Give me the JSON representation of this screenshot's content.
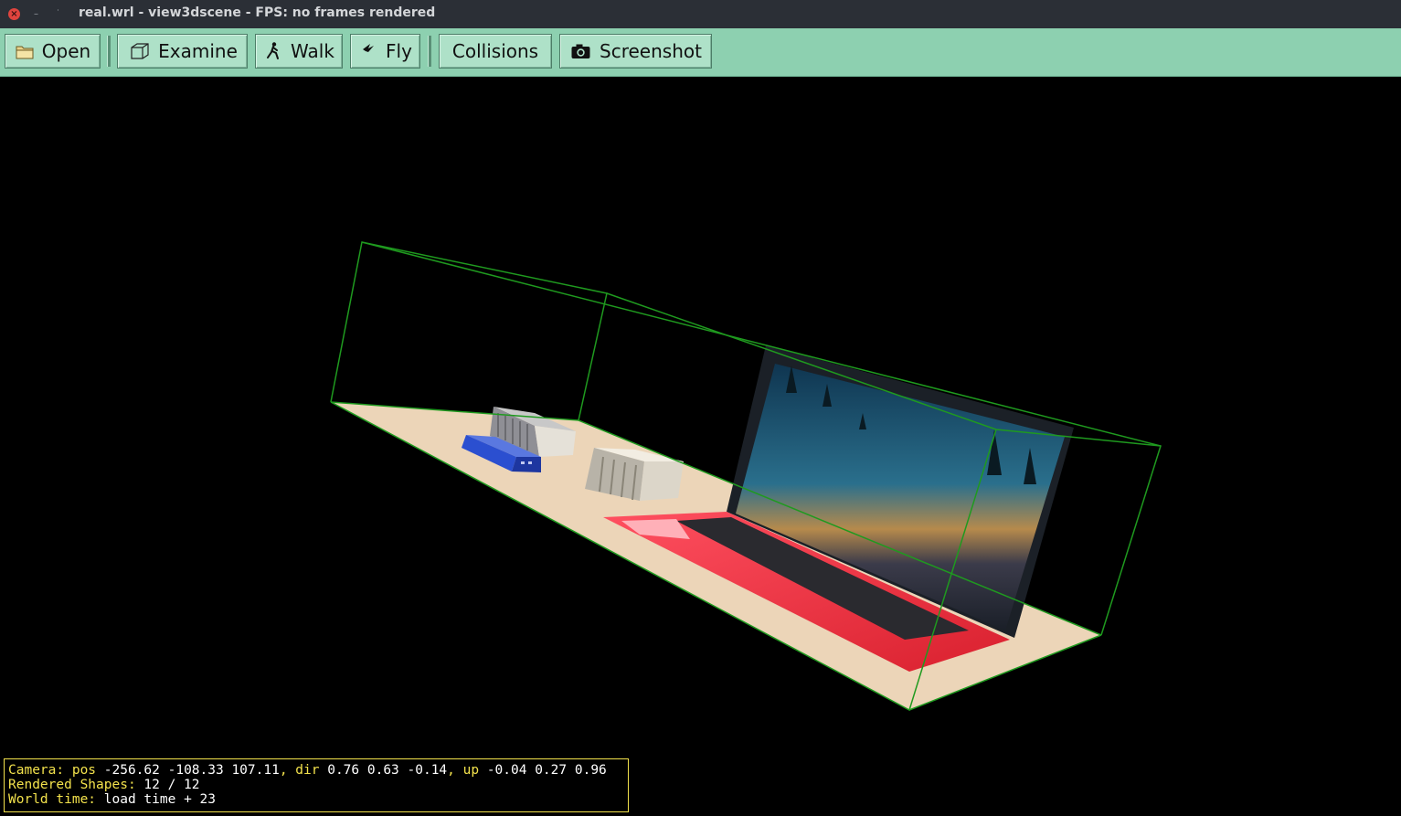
{
  "window": {
    "title": "real.wrl - view3dscene - FPS: no frames rendered"
  },
  "toolbar": {
    "open_label": "Open",
    "examine_label": "Examine",
    "walk_label": "Walk",
    "fly_label": "Fly",
    "collisions_label": "Collisions",
    "screenshot_label": "Screenshot"
  },
  "status": {
    "camera_label": "Camera: pos ",
    "pos_value": "-256.62 -108.33 107.11",
    "dir_label": ", dir ",
    "dir_value": "0.76 0.63 -0.14",
    "up_label": ", up ",
    "up_value": "-0.04 0.27 0.96",
    "shapes_label": "Rendered Shapes: ",
    "shapes_value": "12 / 12",
    "time_label": "World time: ",
    "time_value": "load time + 23"
  },
  "colors": {
    "toolbar_bg": "#8dd0b0",
    "bbox_green": "#1f9a1f",
    "status_yellow": "#f3e24c"
  },
  "icons": [
    "close-icon",
    "minimize-icon",
    "restore-icon",
    "folder-icon",
    "cube-icon",
    "walk-icon",
    "fly-icon",
    "camera-icon"
  ]
}
